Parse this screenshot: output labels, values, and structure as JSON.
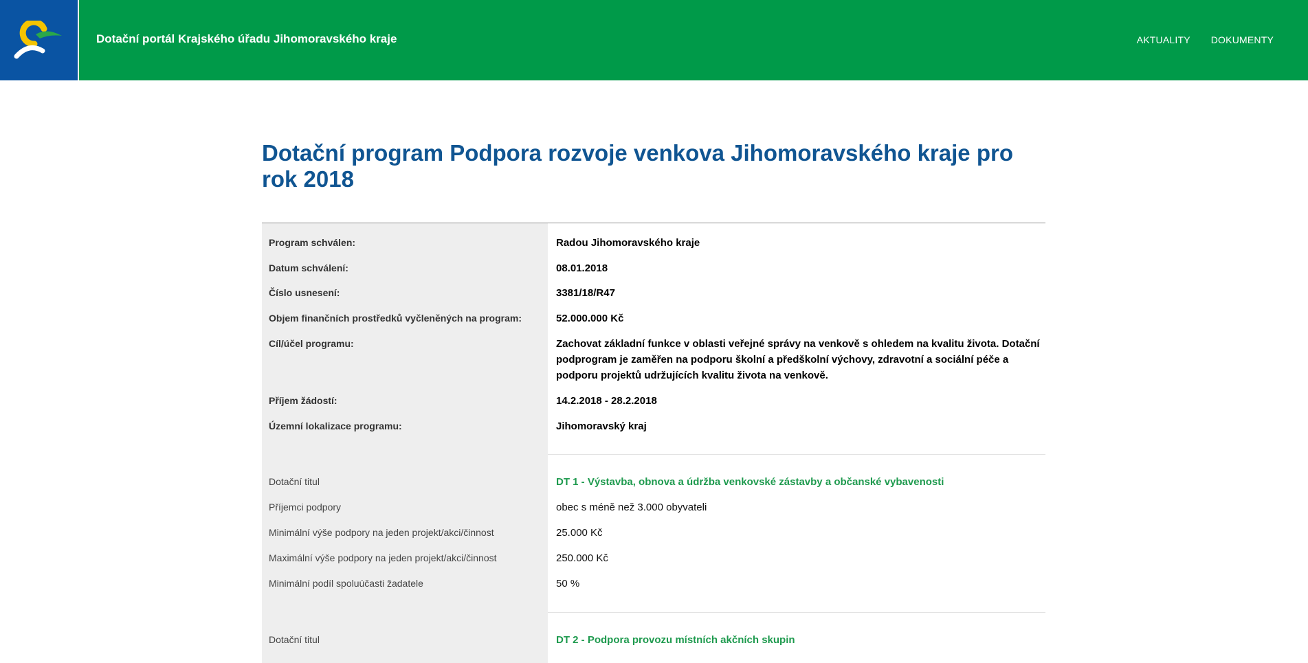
{
  "header": {
    "portal_title": "Dotační portál Krajského úřadu Jihomoravského kraje",
    "nav": [
      {
        "label": "AKTUALITY"
      },
      {
        "label": "DOKUMENTY"
      }
    ],
    "colors": {
      "bar": "#009a49",
      "logo_bg": "#0a54a3"
    }
  },
  "main": {
    "title": "Dotační program Podpora rozvoje venkova Jihomoravského kraje pro rok 2018",
    "program_info": [
      {
        "label": "Program schválen:",
        "value": "Radou Jihomoravského kraje"
      },
      {
        "label": "Datum schválení:",
        "value": "08.01.2018"
      },
      {
        "label": "Číslo usnesení:",
        "value": "3381/18/R47"
      },
      {
        "label": "Objem finančních prostředků vyčleněných na program:",
        "value": "52.000.000 Kč"
      },
      {
        "label": "Cíl/účel programu:",
        "value": "Zachovat základní funkce v oblasti veřejné správy na venkově s ohledem na kvalitu života. Dotační podprogram je zaměřen na podporu školní a předškolní výchovy, zdravotní a sociální péče a podporu projektů udržujících kvalitu života na venkově."
      },
      {
        "label": "Příjem žádostí:",
        "value": "14.2.2018 - 28.2.2018"
      },
      {
        "label": "Územní lokalizace programu:",
        "value": "Jihomoravský kraj"
      }
    ],
    "titles": [
      {
        "rows": [
          {
            "label": "Dotační titul",
            "value": "DT 1 - Výstavba, obnova a údržba venkovské zástavby a občanské vybavenosti"
          },
          {
            "label": "Příjemci podpory",
            "value": "obec s méně než 3.000 obyvateli"
          },
          {
            "label": "Minimální výše podpory na jeden projekt/akci/činnost",
            "value": "25.000 Kč"
          },
          {
            "label": "Maximální výše podpory na jeden projekt/akci/činnost",
            "value": "250.000 Kč"
          },
          {
            "label": "Minimální podíl spoluúčasti žadatele",
            "value": "50 %"
          }
        ]
      },
      {
        "rows": [
          {
            "label": "Dotační titul",
            "value": "DT 2 - Podpora provozu místních akčních skupin"
          }
        ]
      }
    ],
    "accent_color": "#1e9a4e"
  }
}
